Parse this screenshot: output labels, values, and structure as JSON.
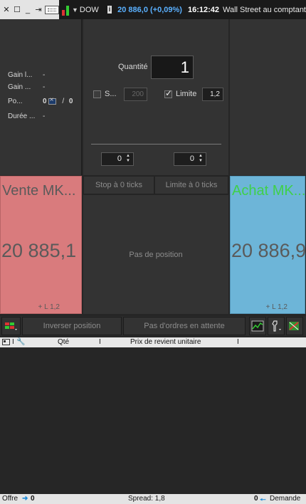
{
  "topbar": {
    "instrument": "DOW",
    "info_icon": "i",
    "price": "20 886,0 (+0,09%)",
    "time": "16:12:42",
    "market": "Wall Street au comptant"
  },
  "stats": {
    "gain1_label": "Gain l...",
    "gain1_value": "-",
    "gain2_label": "Gain ...",
    "gain2_value": "-",
    "pos_label": "Po...",
    "pos_value": "0",
    "pos_sep": "/",
    "pos_total": "0",
    "duree_label": "Durée ...",
    "duree_value": "-"
  },
  "ticket": {
    "quantity_label": "Quantité",
    "quantity_value": "1",
    "stop_label": "S...",
    "stop_value": "200",
    "limit_label": "Limite",
    "limit_value": "1,2",
    "stop_ticks_value": "0",
    "limit_ticks_value": "0"
  },
  "sell": {
    "title": "Vente MK...",
    "price": "20 885,1",
    "limit": "+ L 1,2"
  },
  "buy": {
    "title": "Achat MK...",
    "price": "20 886,9",
    "limit": "+ L 1,2"
  },
  "middle": {
    "stop_btn": "Stop à 0 ticks",
    "limit_btn": "Limite à 0 ticks",
    "no_position": "Pas de position"
  },
  "actions": {
    "reverse": "Inverser position",
    "no_orders": "Pas d'ordres en attente"
  },
  "table": {
    "col_qty": "Qté",
    "col_sep": "I",
    "col_price": "Prix de revient unitaire",
    "col_sep2": "I"
  },
  "footer": {
    "offer_label": "Offre",
    "offer_value": "0",
    "spread": "Spread:  1,8",
    "demand_value": "0",
    "demand_label": "Demande"
  },
  "colors": {
    "sell_bg": "#d97b7d",
    "buy_bg": "#6db5d8",
    "buy_title": "#3fd04a",
    "price_blue": "#5ab0ff"
  }
}
